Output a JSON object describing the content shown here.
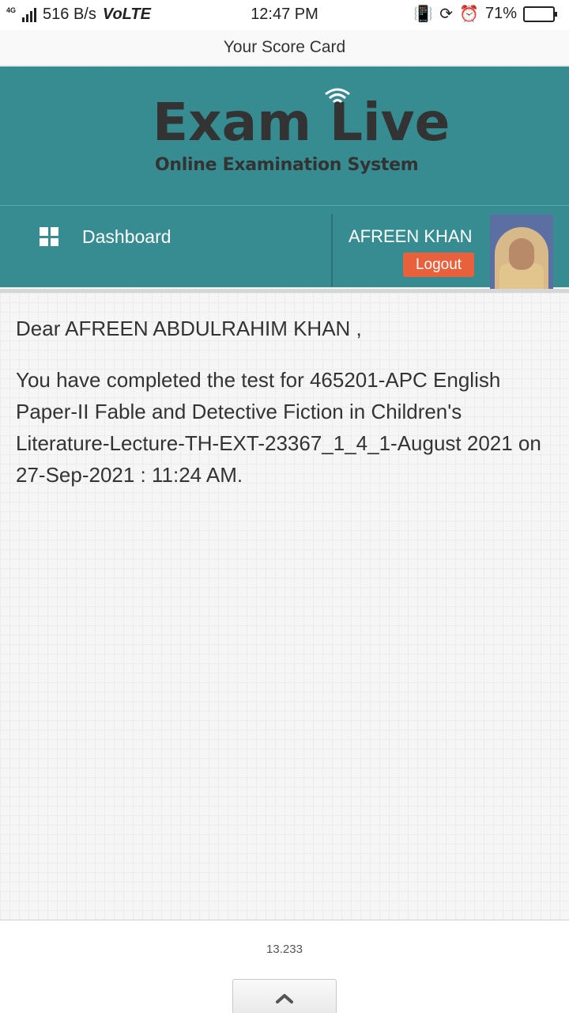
{
  "status_bar": {
    "network_type": "4G",
    "speed": "516 B/s",
    "volte": "VoLTE",
    "time": "12:47 PM",
    "battery": "71%",
    "battery_level": 0.71
  },
  "title_bar": {
    "title": "Your Score Card"
  },
  "brand": {
    "title": "Exam Live",
    "subtitle": "Online Examination System"
  },
  "nav": {
    "dashboard_label": "Dashboard",
    "user_name": "AFREEN KHAN",
    "logout_label": "Logout"
  },
  "content": {
    "greeting": "Dear AFREEN ABDULRAHIM KHAN ,",
    "message": "You have completed the test for 465201-APC English Paper-II Fable and Detective Fiction in Children's Literature-Lecture-TH-EXT-23367_1_4_1-August 2021 on 27-Sep-2021 : 11:24 AM."
  },
  "footer": {
    "version": "13.233"
  },
  "colors": {
    "brand": "#368c91",
    "logout": "#e8613c"
  },
  "icons": [
    "grid-icon",
    "wifi-icon",
    "chevron-up-icon",
    "battery-icon"
  ]
}
